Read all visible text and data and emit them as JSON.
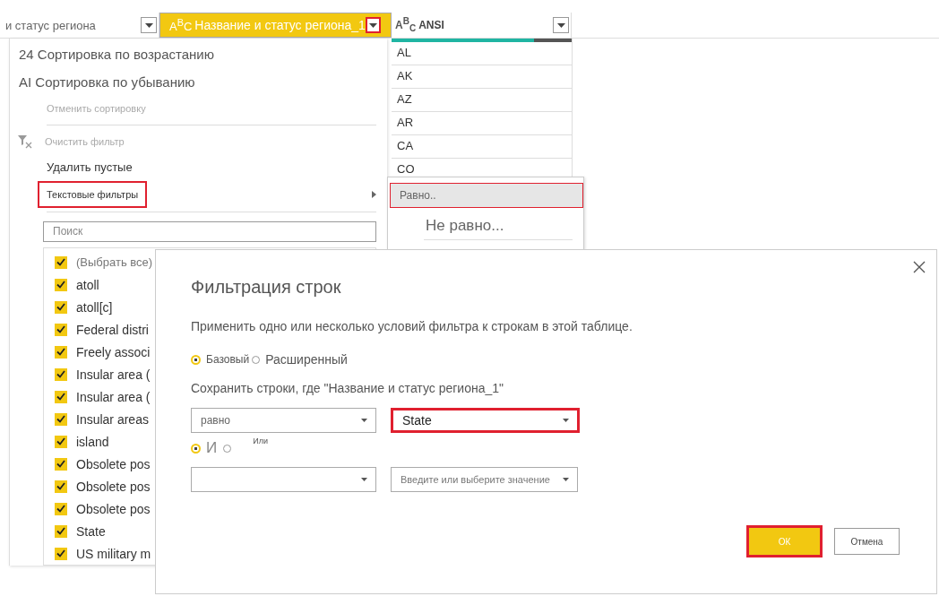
{
  "columns": [
    {
      "title": "и статус региона",
      "selected": false
    },
    {
      "type_label": "A$^{B}$C",
      "title": "Название и статус региона_1",
      "selected": true,
      "highlighted": true
    },
    {
      "type_label": "A$^{B}$$_{C}$",
      "title": "ANSI",
      "selected": false,
      "level": 0.79
    }
  ],
  "ansi_rows": [
    "AL",
    "AK",
    "AZ",
    "AR",
    "CA",
    "CO"
  ],
  "menu": {
    "items": [
      {
        "kind": "large",
        "label": "24 Сортировка по возрастанию",
        "disabled": false
      },
      {
        "kind": "large",
        "label": "AI Сортировка по убыванию",
        "disabled": false
      },
      {
        "kind": "small",
        "label": "Отменить сортировку",
        "disabled": true
      },
      {
        "kind": "divider"
      },
      {
        "kind": "clear_filter",
        "label": "Очистить фильтр",
        "disabled": true
      },
      {
        "kind": "normal",
        "label": "Удалить пустые",
        "disabled": false
      },
      {
        "kind": "submenu",
        "label": "Текстовые фильтры",
        "disabled": false,
        "highlighted": true
      },
      {
        "kind": "divider"
      }
    ],
    "search": {
      "placeholder": "Поиск"
    },
    "checklist": [
      {
        "label": "(Выбрать все)",
        "checked": true
      },
      {
        "label": "atoll",
        "checked": true
      },
      {
        "label": "atoll[c]",
        "checked": true
      },
      {
        "label": "Federal distri",
        "checked": true
      },
      {
        "label": "Freely associ",
        "checked": true
      },
      {
        "label": "Insular area (",
        "checked": true
      },
      {
        "label": "Insular area (",
        "checked": true
      },
      {
        "label": "Insular areas",
        "checked": true
      },
      {
        "label": "island",
        "checked": true
      },
      {
        "label": "Obsolete pos",
        "checked": true
      },
      {
        "label": "Obsolete pos",
        "checked": true
      },
      {
        "label": "Obsolete pos",
        "checked": true
      },
      {
        "label": "State",
        "checked": true
      },
      {
        "label": "US military m",
        "checked": true
      }
    ]
  },
  "submenu": {
    "items": [
      {
        "label": "Равно..",
        "selected": true,
        "highlighted": true
      },
      {
        "label": "Не равно...",
        "selected": false,
        "highlighted": false
      }
    ]
  },
  "dialog": {
    "title": "Фильтрация строк",
    "description": "Применить одно или несколько условий фильтра к строкам в этой таблице.",
    "modes": [
      {
        "label": "Базовый",
        "selected": true
      },
      {
        "label": "Расширенный",
        "selected": false
      }
    ],
    "keep_label": "Сохранить строки, где \"Название и статус региона_1\"",
    "conditions": [
      {
        "operator": "равно",
        "value": "State",
        "value_highlighted": true
      },
      {
        "value_placeholder": "Введите или выберите значение",
        "value_highlighted": false
      }
    ],
    "joins": [
      {
        "label": "И",
        "selected": true
      },
      {
        "label": "Или",
        "selected": false
      }
    ],
    "buttons": [
      {
        "label": "ОК",
        "kind": "primary",
        "highlighted": true
      },
      {
        "label": "Отмена",
        "kind": "secondary",
        "highlighted": false
      }
    ]
  }
}
